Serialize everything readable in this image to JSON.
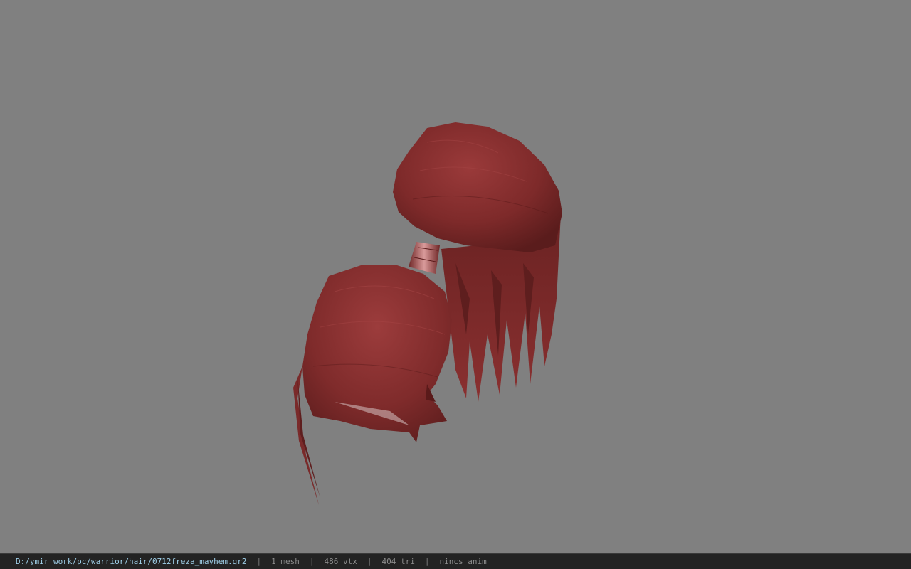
{
  "viewport": {
    "background_color": "#808080",
    "model_color": "#8a2f2f",
    "tie_color": "#c47a7a"
  },
  "statusbar": {
    "file_path": "D:/ymir work/pc/warrior/hair/0712freza_mayhem.gr2",
    "separator": "|",
    "mesh_count": "1 mesh",
    "vertex_count": "486 vtx",
    "triangle_count": "404 tri",
    "animation": "nincs anim"
  }
}
